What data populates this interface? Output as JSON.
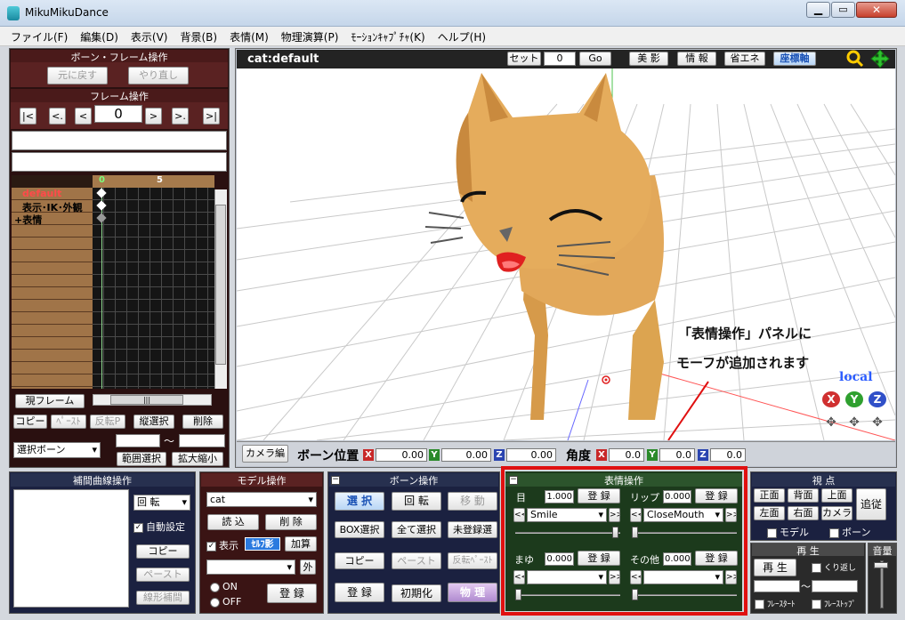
{
  "window": {
    "title": "MikuMikuDance"
  },
  "menu": [
    "ファイル(F)",
    "編集(D)",
    "表示(V)",
    "背景(B)",
    "表情(M)",
    "物理演算(P)",
    "ﾓｰｼｮﾝｷｬﾌﾟﾁｬ(K)",
    "ヘルプ(H)"
  ],
  "bone_frame_op": {
    "title": "ボーン・フレーム操作",
    "undo": "元に戻す",
    "redo": "やり直し"
  },
  "frame_op": {
    "title": "フレーム操作",
    "frame_value": "0",
    "nav": [
      "|<",
      "<.",
      "<",
      ">",
      ">.",
      ">|"
    ]
  },
  "timeline": {
    "tick0": "0",
    "tick5": "5",
    "rows": [
      "default",
      "表示･IK･外観",
      "+表情"
    ],
    "current_frame": "現フレーム",
    "copy": "コピー",
    "paste": "ﾍﾟｰｽﾄ",
    "paste_rev": "反転P",
    "vert_select": "縦選択",
    "delete": "削除",
    "select_bone": "選択ボーン",
    "tilde": "～",
    "range_select": "範囲選択",
    "scale": "拡大縮小"
  },
  "viewport": {
    "model_name": "cat:default",
    "set": "セット",
    "set_value": "0",
    "go": "Go",
    "beauty": "美 影",
    "info": "情 報",
    "eco": "省エネ",
    "axis": "座標軸",
    "local": "local",
    "annotation_line1": "「表情操作」パネルに",
    "annotation_line2": "モーフが追加されます"
  },
  "bone_pos_bar": {
    "camera_edit": "カメラ編",
    "bone_pos": "ボーン位置",
    "x": "X",
    "x_val": "0.00",
    "y": "Y",
    "y_val": "0.00",
    "z": "Z",
    "z_val": "0.00",
    "angle": "角度",
    "ax_val": "0.0",
    "ay_val": "0.0",
    "az_val": "0.0"
  },
  "interp": {
    "title": "補間曲線操作",
    "rotation": "回 転",
    "auto": "自動設定",
    "copy": "コピー",
    "paste": "ペースト",
    "linear": "線形補間"
  },
  "model_op": {
    "title": "モデル操作",
    "model": "cat",
    "load": "読 込",
    "delete": "削 除",
    "show": "表示",
    "self_shadow": "ｾﾙﾌ影",
    "add": "加算",
    "outer": "外",
    "on": "ON",
    "off": "OFF",
    "register": "登 録"
  },
  "bone_op": {
    "title": "ボーン操作",
    "select": "選 択",
    "rotate": "回 転",
    "move": "移 動",
    "box_select": "BOX選択",
    "select_all": "全て選択",
    "unregistered": "未登録選",
    "copy": "コピー",
    "paste": "ペースト",
    "paste_rev": "反転ﾍﾟｰｽﾄ",
    "register": "登 録",
    "reset": "初期化",
    "physics": "物 理"
  },
  "facial_op": {
    "title": "表情操作",
    "eye": {
      "label": "目",
      "value": "1.000",
      "register": "登 録",
      "selected": "Smile",
      "slider": 1.0
    },
    "lip": {
      "label": "リップ",
      "value": "0.000",
      "register": "登 録",
      "selected": "CloseMouth",
      "slider": 0.0
    },
    "brow": {
      "label": "まゆ",
      "value": "0.000",
      "register": "登 録",
      "selected": "",
      "slider": 0.0
    },
    "other": {
      "label": "その他",
      "value": "0.000",
      "register": "登 録",
      "selected": "",
      "slider": 0.0
    }
  },
  "view": {
    "title": "視 点",
    "front": "正面",
    "back": "背面",
    "top": "上面",
    "left": "左面",
    "right": "右面",
    "camera": "カメラ",
    "follow": "追従",
    "model": "モデル",
    "bone": "ボーン"
  },
  "play": {
    "title": "再 生",
    "play": "再 生",
    "loop": "くり返し",
    "tilde": "～",
    "frame_start": "ﾌﾚｰｽﾀｰﾄ",
    "frame_stop": "ﾌﾚｰｽﾄｯﾌﾟ"
  },
  "volume": {
    "title": "音量"
  },
  "colors": {
    "highlight": "#e01010",
    "accent_blue": "#2b5cff"
  }
}
